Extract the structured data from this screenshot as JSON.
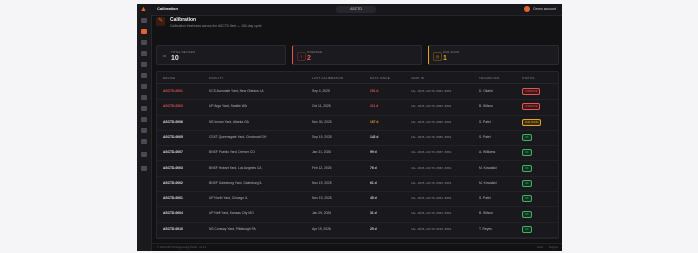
{
  "topbar": {
    "title": "Calibration",
    "context": "ASCTD",
    "user": "Demo account"
  },
  "header": {
    "title": "Calibration",
    "subtitle": "Calibration freshness across the ASCTD fleet — 180-day cycle"
  },
  "stats": [
    {
      "label": "TOTAL DEVICES",
      "value": "10",
      "color": "#d8d8de",
      "icon_color": "#3a3a42",
      "icon": "device-icon"
    },
    {
      "label": "OVERDUE",
      "value": "2",
      "color": "#e55353",
      "icon_color": "#e55353",
      "icon": "alert-icon"
    },
    {
      "label": "DUE SOON",
      "value": "1",
      "color": "#e0a526",
      "icon_color": "#e0a526",
      "icon": "clock-icon"
    }
  ],
  "table": {
    "columns": [
      "DEVICE",
      "FACILITY",
      "LAST CALIBRATION",
      "DAYS SINCE",
      "CERT ID",
      "TECHNICIAN",
      "STATUS"
    ],
    "rows": [
      {
        "device": "ASCTD-0001",
        "facility": "KCS Avondale Yard, New Orleans LA",
        "last": "Sep 4, 2025",
        "days": "251 d",
        "cert": "CAL-2025-ASCTD-0001-0001",
        "tech": "D. Okafor",
        "status": "OVERDUE",
        "state": "overdue"
      },
      {
        "device": "ASCTD-0003",
        "facility": "UP Argo Yard, Seattle WA",
        "last": "Oct 11, 2025",
        "days": "211 d",
        "cert": "CAL-2025-ASCTD-0003-0001",
        "tech": "B. Wilson",
        "status": "OVERDUE",
        "state": "overdue"
      },
      {
        "device": "ASCTD-0006",
        "facility": "NS Inman Yard, Atlanta GA",
        "last": "Nov 30, 2025",
        "days": "167 d",
        "cert": "CAL-2025-ASCTD-0006-0001",
        "tech": "S. Patel",
        "status": "DUE SOON",
        "state": "due"
      },
      {
        "device": "ASCTD-0005",
        "facility": "CSXT Queensgate Yard, Cincinnati OH",
        "last": "Sep 19, 2025",
        "days": "142 d",
        "cert": "CAL-2025-ASCTD-0005-0001",
        "tech": "S. Patel",
        "status": "OK",
        "state": "ok"
      },
      {
        "device": "ASCTD-0007",
        "facility": "BNSF Pueblo Yard, Denver CO",
        "last": "Jan 31, 2026",
        "days": "99 d",
        "cert": "CAL-2026-ASCTD-0007-0001",
        "tech": "A. Williams",
        "status": "OK",
        "state": "ok"
      },
      {
        "device": "ASCTD-0003",
        "facility": "BNSF Hobart Yard, Los Angeles CA",
        "last": "Feb 12, 2026",
        "days": "76 d",
        "cert": "CAL-2026-ASCTD-0003-0001",
        "tech": "M. Kowalski",
        "status": "OK",
        "state": "ok"
      },
      {
        "device": "ASCTD-0002",
        "facility": "BNSF Galesburg Yard, Galesburg IL",
        "last": "Nov 19, 2025",
        "days": "61 d",
        "cert": "CAL-2025-ASCTD-0002-0001",
        "tech": "M. Kowalski",
        "status": "OK",
        "state": "ok"
      },
      {
        "device": "ASCTD-0001",
        "facility": "UP North Yard, Chicago IL",
        "last": "Nov 19, 2025",
        "days": "45 d",
        "cert": "CAL-2025-ASCTD-0001-0002",
        "tech": "S. Patel",
        "status": "OK",
        "state": "ok"
      },
      {
        "device": "ASCTD-0004",
        "facility": "UP Neff Yard, Kansas City MO",
        "last": "Jan 29, 2026",
        "days": "31 d",
        "cert": "CAL-2026-ASCTD-0004-0001",
        "tech": "B. Wilson",
        "status": "OK",
        "state": "ok"
      },
      {
        "device": "ASCTD-0010",
        "facility": "NS Conway Yard, Pittsburgh PA",
        "last": "Apr 19, 2026",
        "days": "25 d",
        "cert": "CAL-2026-ASCTD-0010-0001",
        "tech": "T. Reyes",
        "status": "OK",
        "state": "ok"
      }
    ]
  },
  "footer": {
    "left": "© 2026 ASCTD Engineering Portal · v2.4.0",
    "links": [
      "Docs",
      "Support"
    ]
  },
  "colors": {
    "accent": "#e0652b",
    "overdue": "#e55353",
    "due": "#e0a526",
    "ok": "#3fb06a"
  }
}
